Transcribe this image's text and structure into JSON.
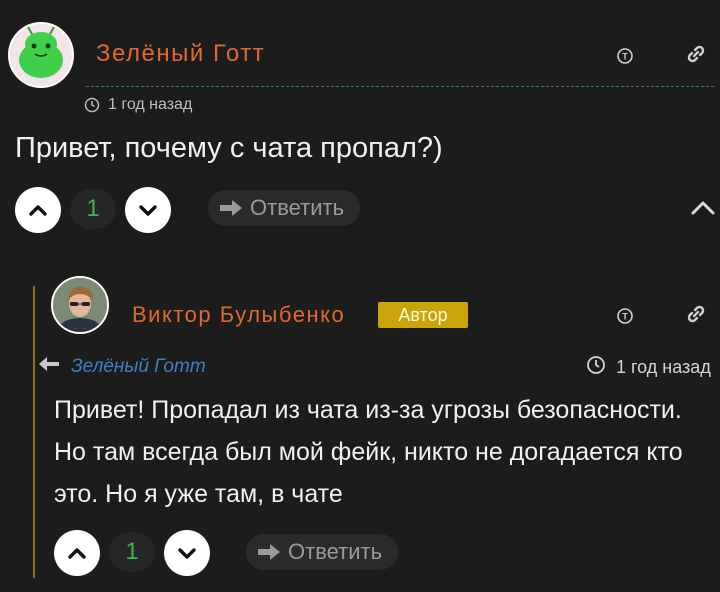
{
  "comment": {
    "author": "Зелёный Готт",
    "time": "1 год назад",
    "text": "Привет, почему с чата пропал?)",
    "votes": "1",
    "reply_label": "Ответить"
  },
  "reply": {
    "author": "Виктор Булыбенко",
    "badge": "Автор",
    "reply_to": "Зелёный Готт",
    "time": "1 год назад",
    "text_lines": [
      "Привет! Пропадал из чата из-за угрозы безопасности.",
      "Но там всегда был мой фейк, никто не догадается кто",
      "это. Но я уже там, в чате"
    ],
    "votes": "1",
    "reply_label": "Ответить"
  },
  "colors": {
    "author": "#e06a2c",
    "vote_count": "#3bb54a",
    "badge": "#c9a40a",
    "reply_to_link": "#3f7fc4",
    "thread_line": "#8a7420"
  },
  "icons": [
    "clock-icon",
    "copyright-icon",
    "link-icon",
    "chevron-up-icon",
    "chevron-down-icon",
    "reply-arrow-icon",
    "collapse-icon"
  ]
}
